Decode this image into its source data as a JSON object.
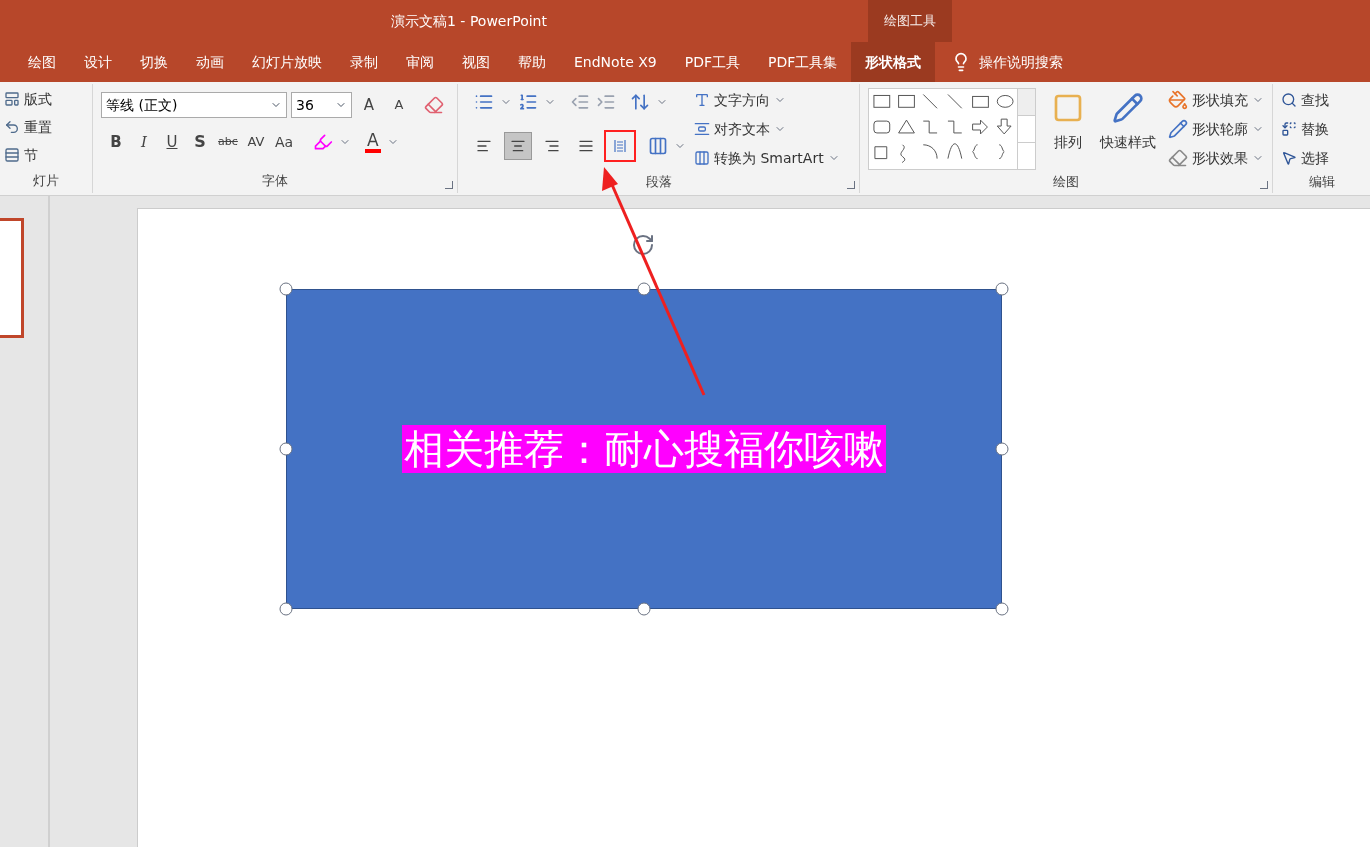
{
  "window": {
    "title": "演示文稿1  -  PowerPoint",
    "context_label": "绘图工具"
  },
  "tabs": [
    {
      "label": "绘图",
      "selected": false
    },
    {
      "label": "设计",
      "selected": false
    },
    {
      "label": "切换",
      "selected": false
    },
    {
      "label": "动画",
      "selected": false
    },
    {
      "label": "幻灯片放映",
      "selected": false
    },
    {
      "label": "录制",
      "selected": false
    },
    {
      "label": "审阅",
      "selected": false
    },
    {
      "label": "视图",
      "selected": false
    },
    {
      "label": "帮助",
      "selected": false
    },
    {
      "label": "EndNote X9",
      "selected": false
    },
    {
      "label": "PDF工具",
      "selected": false
    },
    {
      "label": "PDF工具集",
      "selected": false
    },
    {
      "label": "形状格式",
      "selected": true
    }
  ],
  "tell_me": {
    "label": "操作说明搜索"
  },
  "ribbon": {
    "slides_group": {
      "label": "灯片",
      "items": [
        "版式",
        "重置",
        "节"
      ]
    },
    "font_group": {
      "label": "字体",
      "font_name": "等线 (正文)",
      "font_size": "36",
      "grow_label": "A",
      "shrink_label": "A",
      "styles": [
        "B",
        "I",
        "U",
        "S",
        "abc",
        "AV",
        "Aa"
      ],
      "font_color_label": "A"
    },
    "paragraph_group": {
      "label": "段落",
      "align_buttons": [
        {
          "selected": false,
          "annotated": false
        },
        {
          "selected": true,
          "annotated": false
        },
        {
          "selected": false,
          "annotated": false
        },
        {
          "selected": false,
          "annotated": false
        },
        {
          "selected": false,
          "annotated": true
        }
      ],
      "text_commands": [
        "文字方向",
        "对齐文本",
        "转换为 SmartArt"
      ]
    },
    "drawing_group": {
      "label": "绘图",
      "arrange": "排列",
      "quick_styles": "快速样式",
      "shape_commands": [
        "形状填充",
        "形状轮廓",
        "形状效果"
      ]
    },
    "editing_group": {
      "label": "编辑",
      "commands": [
        "查找",
        "替换",
        "选择"
      ]
    }
  },
  "slide": {
    "shape_text": "相关推荐：耐心搜福你咳嗽"
  }
}
